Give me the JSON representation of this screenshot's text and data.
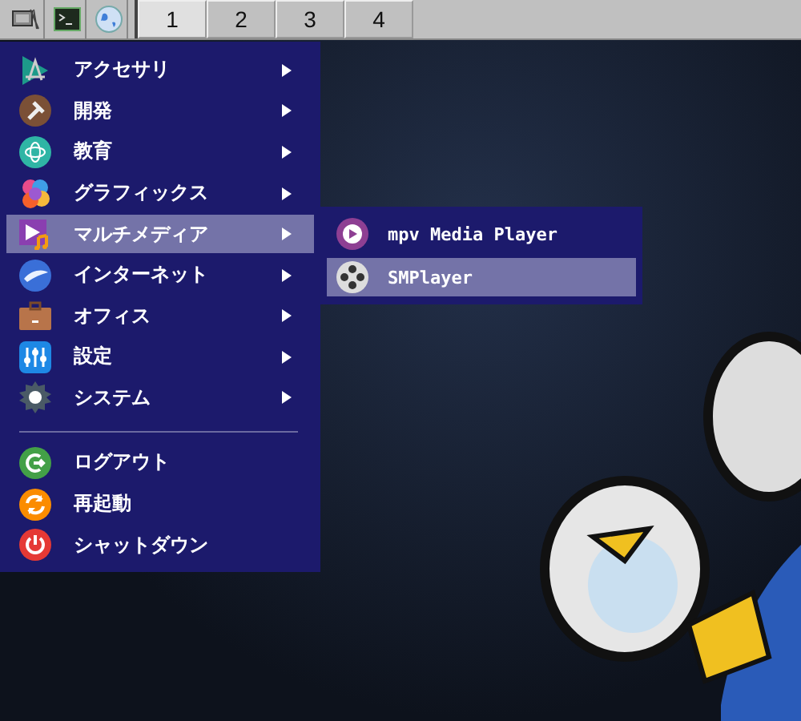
{
  "taskbar": {
    "desktops": [
      {
        "label": "1",
        "selected": true
      },
      {
        "label": "2",
        "selected": false
      },
      {
        "label": "3",
        "selected": false
      },
      {
        "label": "4",
        "selected": false
      }
    ]
  },
  "menu": {
    "groups": [
      [
        {
          "label": "アクセサリ",
          "kind": "submenu",
          "selected": false
        },
        {
          "label": "開発",
          "kind": "submenu",
          "selected": false
        },
        {
          "label": "教育",
          "kind": "submenu",
          "selected": false
        },
        {
          "label": "グラフィックス",
          "kind": "submenu",
          "selected": false
        },
        {
          "label": "マルチメディア",
          "kind": "submenu",
          "selected": true
        },
        {
          "label": "インターネット",
          "kind": "submenu",
          "selected": false
        },
        {
          "label": "オフィス",
          "kind": "submenu",
          "selected": false
        },
        {
          "label": "設定",
          "kind": "submenu",
          "selected": false
        },
        {
          "label": "システム",
          "kind": "submenu",
          "selected": false
        }
      ],
      [
        {
          "label": "ログアウト",
          "kind": "action",
          "selected": false
        },
        {
          "label": "再起動",
          "kind": "action",
          "selected": false
        },
        {
          "label": "シャットダウン",
          "kind": "action",
          "selected": false
        }
      ]
    ]
  },
  "submenu": {
    "items": [
      {
        "label": "mpv Media Player",
        "selected": false
      },
      {
        "label": "SMPlayer",
        "selected": true
      }
    ]
  }
}
